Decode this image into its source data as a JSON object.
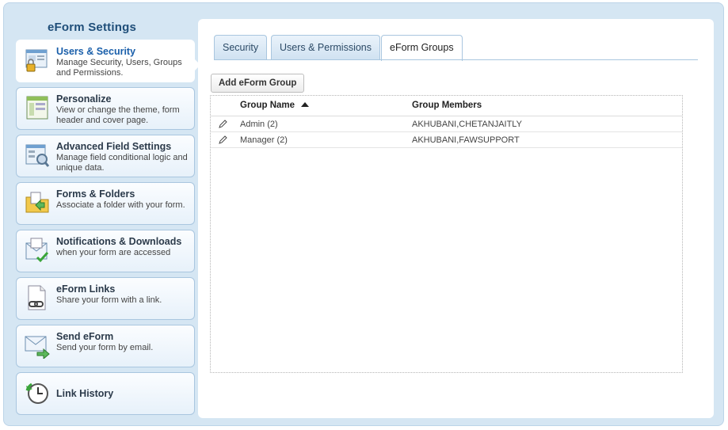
{
  "sidebar": {
    "title": "eForm Settings",
    "items": [
      {
        "label": "Users & Security",
        "desc": "Manage Security, Users, Groups and Permissions.",
        "icon": "users-security-icon"
      },
      {
        "label": "Personalize",
        "desc": "View or change the theme, form header and cover page.",
        "icon": "personalize-icon"
      },
      {
        "label": "Advanced Field Settings",
        "desc": "Manage field conditional logic and unique data.",
        "icon": "advanced-field-icon"
      },
      {
        "label": "Forms & Folders",
        "desc": "Associate a folder with your form.",
        "icon": "folder-icon"
      },
      {
        "label": "Notifications & Downloads",
        "desc": "when your form are accessed",
        "icon": "notification-icon"
      },
      {
        "label": "eForm Links",
        "desc": "Share your form with a link.",
        "icon": "link-icon"
      },
      {
        "label": "Send eForm",
        "desc": "Send your form by email.",
        "icon": "email-icon"
      },
      {
        "label": "Link History",
        "desc": "",
        "icon": "clock-icon"
      }
    ]
  },
  "tabs": [
    {
      "label": "Security"
    },
    {
      "label": "Users & Permissions"
    },
    {
      "label": "eForm Groups"
    }
  ],
  "add_button": "Add eForm Group",
  "table": {
    "columns": [
      "Group Name",
      "Group Members"
    ],
    "rows": [
      {
        "name": "Admin (2)",
        "members": "AKHUBANI,CHETANJAITLY"
      },
      {
        "name": "Manager (2)",
        "members": "AKHUBANI,FAWSUPPORT"
      }
    ]
  },
  "colors": {
    "accent": "#1a5faa",
    "panel_bg": "#d5e6f3",
    "border": "#a9c6df"
  }
}
